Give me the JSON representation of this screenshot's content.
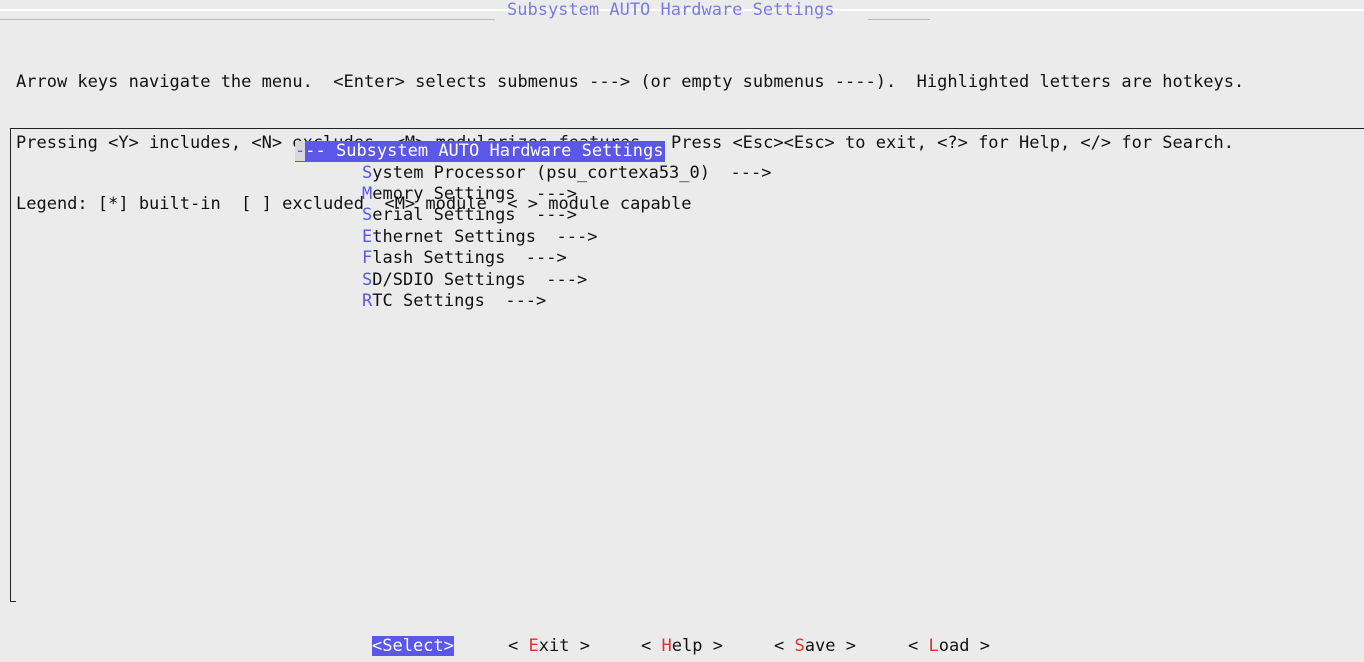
{
  "dialog": {
    "title": "Subsystem AUTO Hardware Settings",
    "help_lines": [
      "Arrow keys navigate the menu.  <Enter> selects submenus ---> (or empty submenus ----).  Highlighted letters are hotkeys.",
      "Pressing <Y> includes, <N> excludes, <M> modularizes features.  Press <Esc><Esc> to exit, <?> for Help, </> for Search.",
      "Legend: [*] built-in  [ ] excluded  <M> module  < > module capable"
    ]
  },
  "menu": {
    "header": {
      "prefix": "---",
      "label": "Subsystem AUTO Hardware Settings"
    },
    "items": [
      {
        "hotkey": "S",
        "rest": "ystem Processor (psu_cortexa53_0)",
        "arrow": "--->"
      },
      {
        "hotkey": "M",
        "rest": "emory Settings",
        "arrow": "--->"
      },
      {
        "hotkey": "S",
        "rest": "erial Settings",
        "arrow": "--->"
      },
      {
        "hotkey": "E",
        "rest": "thernet Settings",
        "arrow": "--->"
      },
      {
        "hotkey": "F",
        "rest": "lash Settings",
        "arrow": "--->"
      },
      {
        "hotkey": "S",
        "rest": "D/SDIO Settings",
        "arrow": "--->"
      },
      {
        "hotkey": "R",
        "rest": "TC Settings",
        "arrow": "--->"
      }
    ]
  },
  "buttons": {
    "select": "<Select>",
    "exit": {
      "pre": "< ",
      "hotkey": "E",
      "rest": "xit",
      "post": " >"
    },
    "help": {
      "pre": "< ",
      "hotkey": "H",
      "rest": "elp",
      "post": " >"
    },
    "save": {
      "pre": "< ",
      "hotkey": "S",
      "rest": "ave",
      "post": " >"
    },
    "load": {
      "pre": "< ",
      "hotkey": "L",
      "rest": "oad",
      "post": " >"
    }
  },
  "colors": {
    "highlight": "#5b57e8",
    "hotkey_menu": "#5b57e8",
    "hotkey_button": "#e03030",
    "title": "#7b7ae6",
    "background": "#ebebeb"
  }
}
